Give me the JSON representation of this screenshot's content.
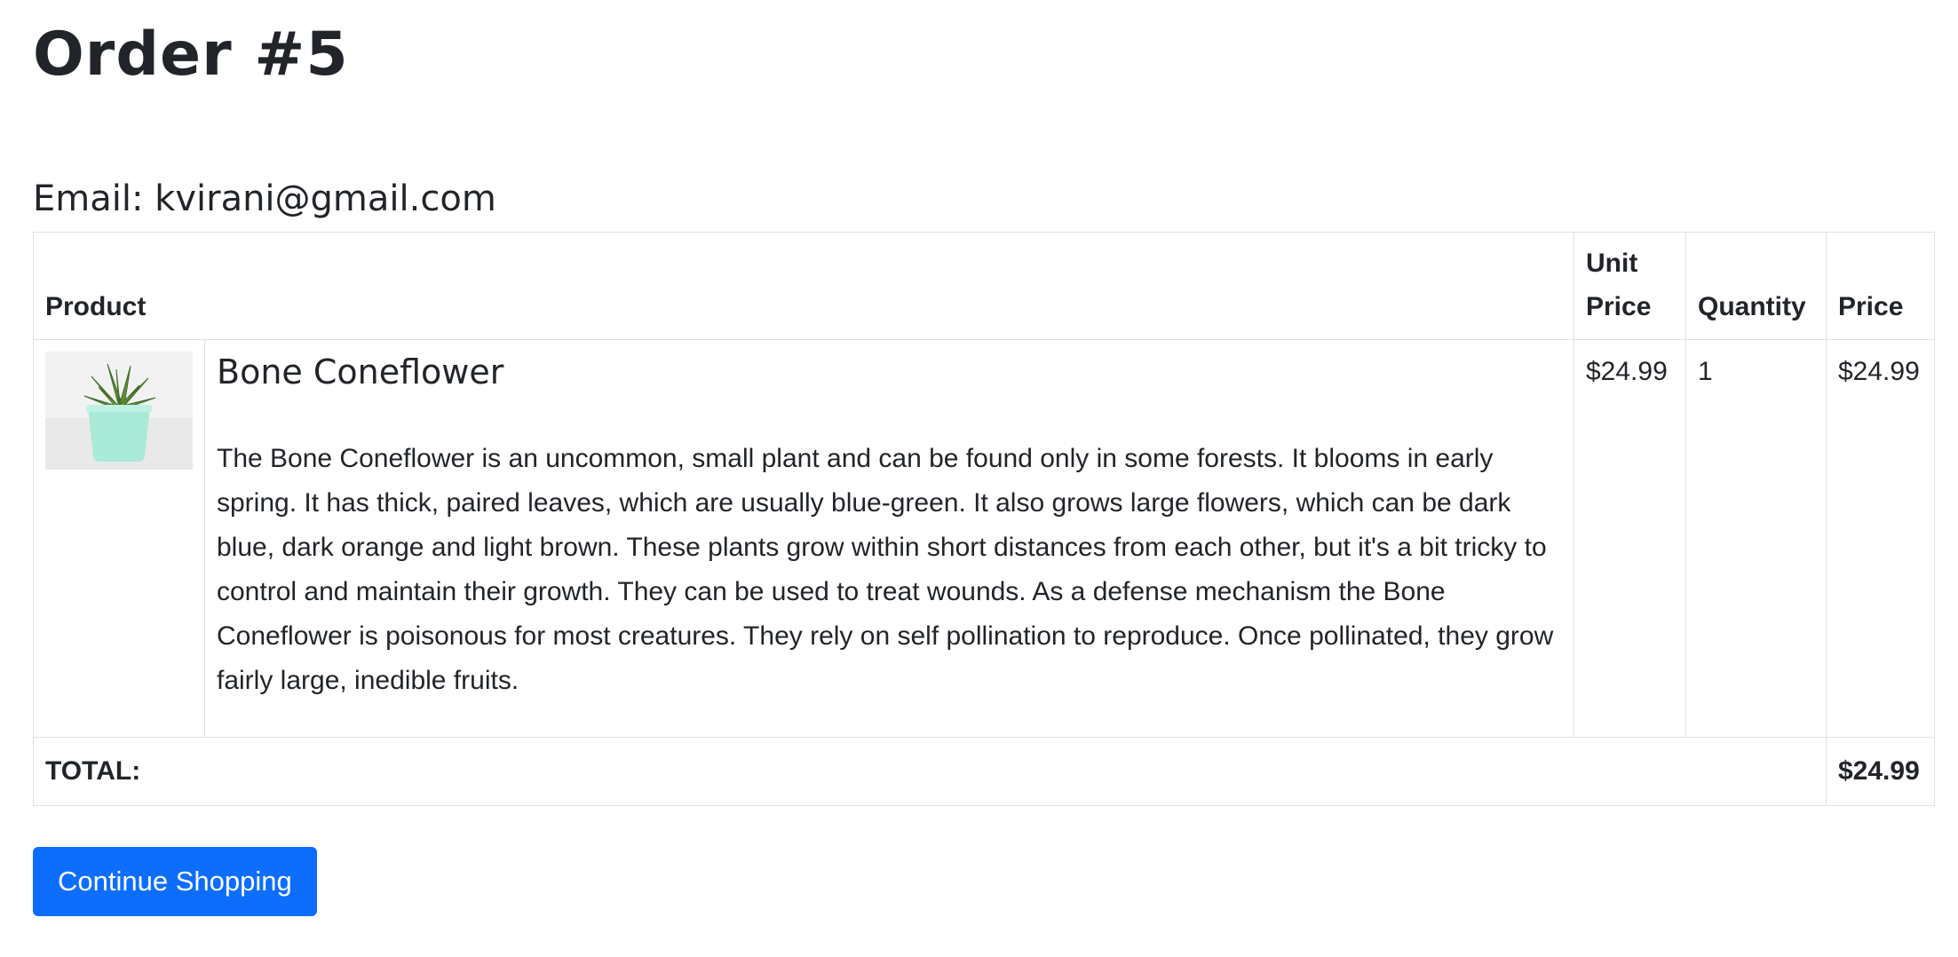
{
  "order": {
    "title": "Order #5",
    "email_line": "Email: kvirani@gmail.com"
  },
  "table": {
    "headers": {
      "product": "Product",
      "unit_price": "Unit Price",
      "quantity": "Quantity",
      "price": "Price"
    },
    "items": [
      {
        "image_icon": "potted-succulent",
        "name": "Bone Coneflower",
        "description": "The Bone Coneflower is an uncommon, small plant and can be found only in some forests. It blooms in early spring. It has thick, paired leaves, which are usually blue-green. It also grows large flowers, which can be dark blue, dark orange and light brown. These plants grow within short distances from each other, but it's a bit tricky to control and maintain their growth. They can be used to treat wounds. As a defense mechanism the Bone Coneflower is poisonous for most creatures. They rely on self pollination to reproduce. Once pollinated, they grow fairly large, inedible fruits.",
        "unit_price": "$24.99",
        "quantity": "1",
        "price": "$24.99"
      }
    ],
    "total_label": "TOTAL:",
    "total_value": "$24.99"
  },
  "actions": {
    "continue_label": "Continue Shopping"
  },
  "colors": {
    "primary": "#0d6efd",
    "text": "#212529",
    "border": "#dee2e6"
  }
}
